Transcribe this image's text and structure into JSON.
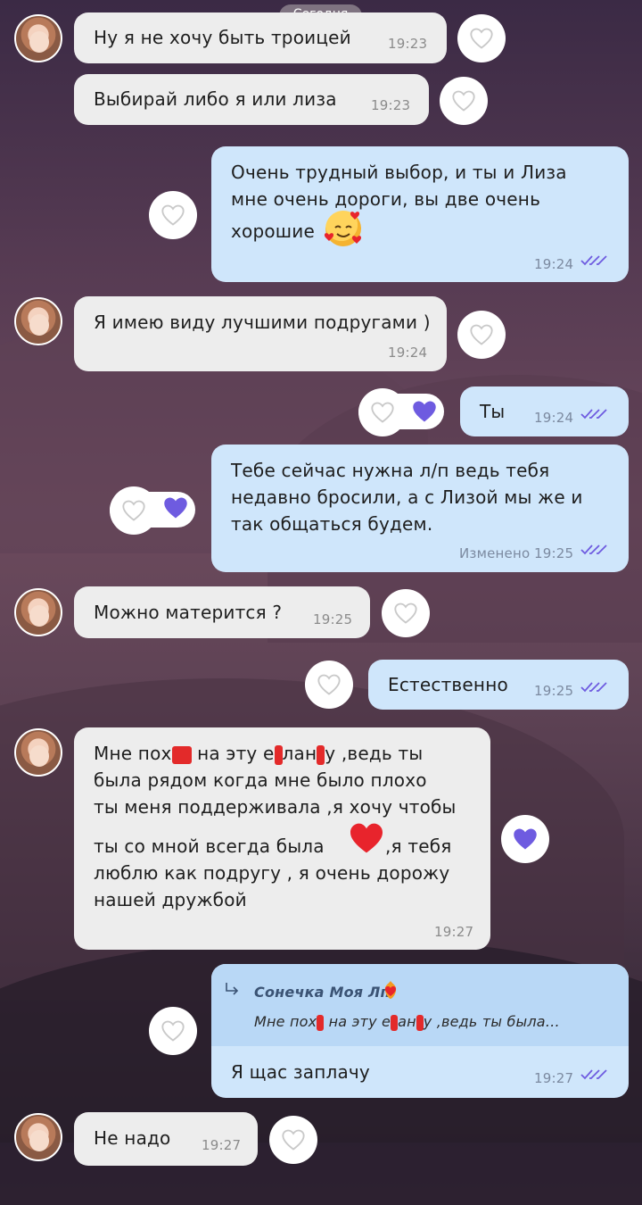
{
  "date_label": "Сегодня",
  "messages": [
    {
      "text": "Ну я не хочу быть троицей",
      "time": "19:23"
    },
    {
      "text": "Выбирай либо я или лиза",
      "time": "19:23"
    },
    {
      "line1": "Очень трудный выбор, и ты и Лиза",
      "line2": "мне очень дороги, вы две очень",
      "line3": "хорошие",
      "emoji": "smiling-face-with-hearts",
      "time": "19:24"
    },
    {
      "text": "Я имею виду лучшими подругами )",
      "time": "19:24"
    },
    {
      "text": "Ты",
      "time": "19:24"
    },
    {
      "line1": "Тебе сейчас нужна л/п ведь тебя",
      "line2": "недавно бросили, а с Лизой мы же и",
      "line3": "так общаться будем.",
      "edited": "Изменено",
      "time": "19:25"
    },
    {
      "text": "Можно матерится ?",
      "time": "19:25"
    },
    {
      "text": "Естественно",
      "time": "19:25"
    },
    {
      "line1a": "Мне пох",
      "line1b": " на эту е",
      "line1c": "лан",
      "line1d": "у ,ведь ты",
      "line2": "была рядом когда мне было плохо",
      "line3": "ты меня поддерживала ,я хочу чтобы",
      "line4a": "ты со мной всегда была",
      "line4b": ",я тебя",
      "line5": "люблю как подругу , я очень дорожу",
      "line6": "нашей дружбой",
      "time": "19:27"
    },
    {
      "reply_name": "Сонечка Моя Лп",
      "reply_a": "Мне пох",
      "reply_b": " на эту е",
      "reply_c": "ан",
      "reply_d": "у ,ведь ты была…",
      "text": "Я щас заплачу",
      "time": "19:27"
    },
    {
      "text": "Не надо",
      "time": "19:27"
    }
  ],
  "colors": {
    "incoming": "#ededed",
    "outgoing": "#cfe6fb",
    "accent": "#6e5be0",
    "heart": "#e8242c"
  }
}
